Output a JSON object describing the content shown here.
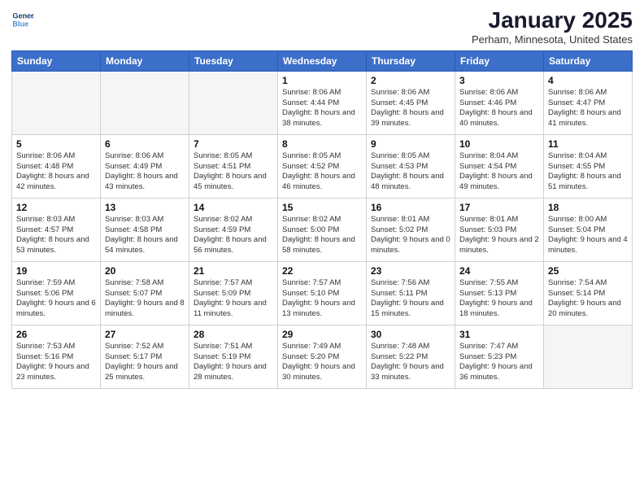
{
  "logo": {
    "line1": "General",
    "line2": "Blue"
  },
  "title": "January 2025",
  "location": "Perham, Minnesota, United States",
  "days_header": [
    "Sunday",
    "Monday",
    "Tuesday",
    "Wednesday",
    "Thursday",
    "Friday",
    "Saturday"
  ],
  "weeks": [
    [
      {
        "day": "",
        "info": ""
      },
      {
        "day": "",
        "info": ""
      },
      {
        "day": "",
        "info": ""
      },
      {
        "day": "1",
        "info": "Sunrise: 8:06 AM\nSunset: 4:44 PM\nDaylight: 8 hours\nand 38 minutes."
      },
      {
        "day": "2",
        "info": "Sunrise: 8:06 AM\nSunset: 4:45 PM\nDaylight: 8 hours\nand 39 minutes."
      },
      {
        "day": "3",
        "info": "Sunrise: 8:06 AM\nSunset: 4:46 PM\nDaylight: 8 hours\nand 40 minutes."
      },
      {
        "day": "4",
        "info": "Sunrise: 8:06 AM\nSunset: 4:47 PM\nDaylight: 8 hours\nand 41 minutes."
      }
    ],
    [
      {
        "day": "5",
        "info": "Sunrise: 8:06 AM\nSunset: 4:48 PM\nDaylight: 8 hours\nand 42 minutes."
      },
      {
        "day": "6",
        "info": "Sunrise: 8:06 AM\nSunset: 4:49 PM\nDaylight: 8 hours\nand 43 minutes."
      },
      {
        "day": "7",
        "info": "Sunrise: 8:05 AM\nSunset: 4:51 PM\nDaylight: 8 hours\nand 45 minutes."
      },
      {
        "day": "8",
        "info": "Sunrise: 8:05 AM\nSunset: 4:52 PM\nDaylight: 8 hours\nand 46 minutes."
      },
      {
        "day": "9",
        "info": "Sunrise: 8:05 AM\nSunset: 4:53 PM\nDaylight: 8 hours\nand 48 minutes."
      },
      {
        "day": "10",
        "info": "Sunrise: 8:04 AM\nSunset: 4:54 PM\nDaylight: 8 hours\nand 49 minutes."
      },
      {
        "day": "11",
        "info": "Sunrise: 8:04 AM\nSunset: 4:55 PM\nDaylight: 8 hours\nand 51 minutes."
      }
    ],
    [
      {
        "day": "12",
        "info": "Sunrise: 8:03 AM\nSunset: 4:57 PM\nDaylight: 8 hours\nand 53 minutes."
      },
      {
        "day": "13",
        "info": "Sunrise: 8:03 AM\nSunset: 4:58 PM\nDaylight: 8 hours\nand 54 minutes."
      },
      {
        "day": "14",
        "info": "Sunrise: 8:02 AM\nSunset: 4:59 PM\nDaylight: 8 hours\nand 56 minutes."
      },
      {
        "day": "15",
        "info": "Sunrise: 8:02 AM\nSunset: 5:00 PM\nDaylight: 8 hours\nand 58 minutes."
      },
      {
        "day": "16",
        "info": "Sunrise: 8:01 AM\nSunset: 5:02 PM\nDaylight: 9 hours\nand 0 minutes."
      },
      {
        "day": "17",
        "info": "Sunrise: 8:01 AM\nSunset: 5:03 PM\nDaylight: 9 hours\nand 2 minutes."
      },
      {
        "day": "18",
        "info": "Sunrise: 8:00 AM\nSunset: 5:04 PM\nDaylight: 9 hours\nand 4 minutes."
      }
    ],
    [
      {
        "day": "19",
        "info": "Sunrise: 7:59 AM\nSunset: 5:06 PM\nDaylight: 9 hours\nand 6 minutes."
      },
      {
        "day": "20",
        "info": "Sunrise: 7:58 AM\nSunset: 5:07 PM\nDaylight: 9 hours\nand 8 minutes."
      },
      {
        "day": "21",
        "info": "Sunrise: 7:57 AM\nSunset: 5:09 PM\nDaylight: 9 hours\nand 11 minutes."
      },
      {
        "day": "22",
        "info": "Sunrise: 7:57 AM\nSunset: 5:10 PM\nDaylight: 9 hours\nand 13 minutes."
      },
      {
        "day": "23",
        "info": "Sunrise: 7:56 AM\nSunset: 5:11 PM\nDaylight: 9 hours\nand 15 minutes."
      },
      {
        "day": "24",
        "info": "Sunrise: 7:55 AM\nSunset: 5:13 PM\nDaylight: 9 hours\nand 18 minutes."
      },
      {
        "day": "25",
        "info": "Sunrise: 7:54 AM\nSunset: 5:14 PM\nDaylight: 9 hours\nand 20 minutes."
      }
    ],
    [
      {
        "day": "26",
        "info": "Sunrise: 7:53 AM\nSunset: 5:16 PM\nDaylight: 9 hours\nand 23 minutes."
      },
      {
        "day": "27",
        "info": "Sunrise: 7:52 AM\nSunset: 5:17 PM\nDaylight: 9 hours\nand 25 minutes."
      },
      {
        "day": "28",
        "info": "Sunrise: 7:51 AM\nSunset: 5:19 PM\nDaylight: 9 hours\nand 28 minutes."
      },
      {
        "day": "29",
        "info": "Sunrise: 7:49 AM\nSunset: 5:20 PM\nDaylight: 9 hours\nand 30 minutes."
      },
      {
        "day": "30",
        "info": "Sunrise: 7:48 AM\nSunset: 5:22 PM\nDaylight: 9 hours\nand 33 minutes."
      },
      {
        "day": "31",
        "info": "Sunrise: 7:47 AM\nSunset: 5:23 PM\nDaylight: 9 hours\nand 36 minutes."
      },
      {
        "day": "",
        "info": ""
      }
    ]
  ]
}
